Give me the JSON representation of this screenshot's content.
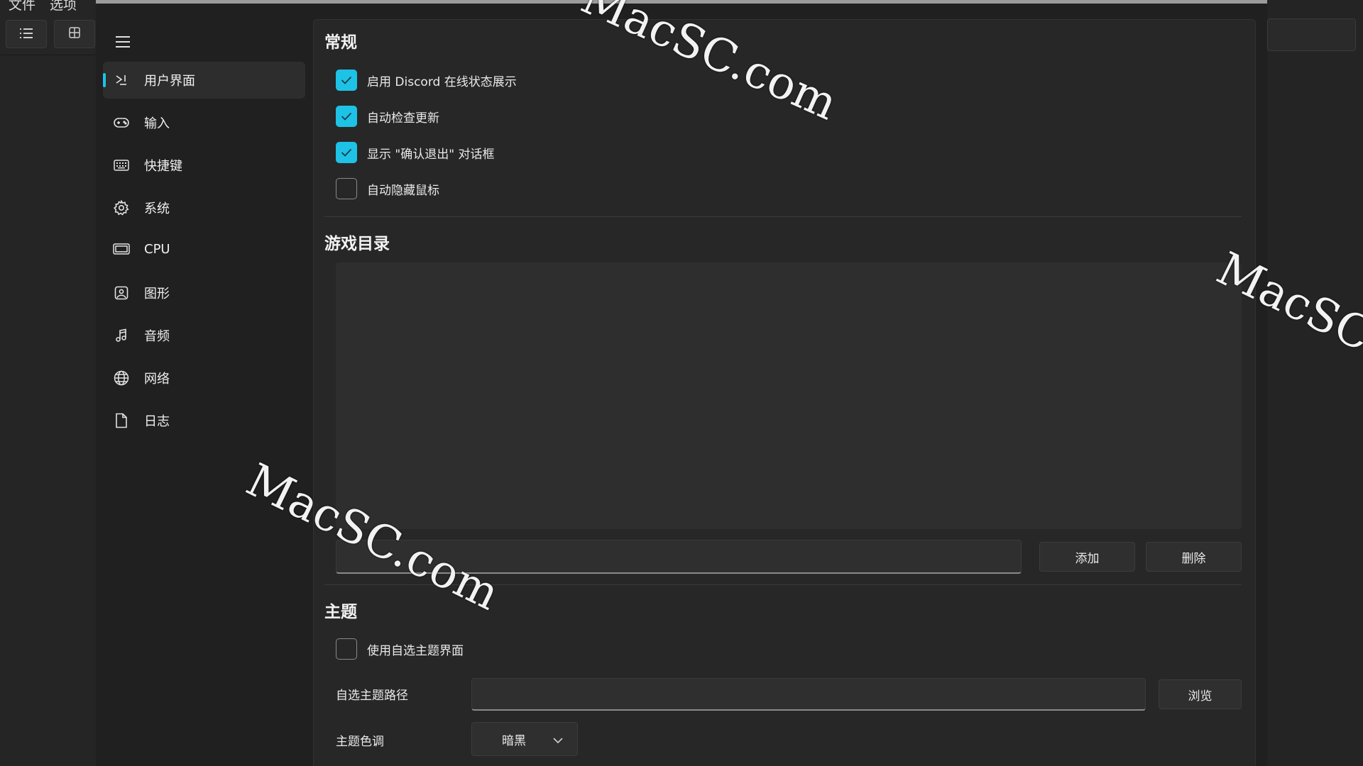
{
  "background_app": {
    "menubar": [
      "文件",
      "选项"
    ],
    "toolbar": {
      "list_icon": "list-icon",
      "grid_icon": "grid-icon"
    }
  },
  "nav": {
    "menu_icon": "hamburger-icon",
    "items": [
      {
        "label": "用户界面",
        "icon": "ui-icon",
        "active": true
      },
      {
        "label": "输入",
        "icon": "gamepad-icon"
      },
      {
        "label": "快捷键",
        "icon": "keyboard-icon"
      },
      {
        "label": "系统",
        "icon": "gear-icon"
      },
      {
        "label": "CPU",
        "icon": "cpu-icon"
      },
      {
        "label": "图形",
        "icon": "image-icon"
      },
      {
        "label": "音频",
        "icon": "music-icon"
      },
      {
        "label": "网络",
        "icon": "globe-icon"
      },
      {
        "label": "日志",
        "icon": "document-icon"
      }
    ]
  },
  "general": {
    "title": "常规",
    "options": [
      {
        "label": "启用 Discord 在线状态展示",
        "checked": true
      },
      {
        "label": "自动检查更新",
        "checked": true
      },
      {
        "label": "显示 \"确认退出\" 对话框",
        "checked": true
      },
      {
        "label": "自动隐藏鼠标",
        "checked": false
      }
    ]
  },
  "game_dirs": {
    "title": "游戏目录",
    "input_value": "",
    "add_label": "添加",
    "remove_label": "删除"
  },
  "theme": {
    "title": "主题",
    "custom_theme_label": "使用自选主题界面",
    "custom_theme_checked": false,
    "path_label": "自选主题路径",
    "path_value": "",
    "browse_label": "浏览",
    "color_label": "主题色调",
    "color_value": "暗黑"
  },
  "colors": {
    "accent": "#1ec2e6",
    "panel": "#272727",
    "sidebar": "#202020"
  },
  "watermark": "MacSC.com"
}
